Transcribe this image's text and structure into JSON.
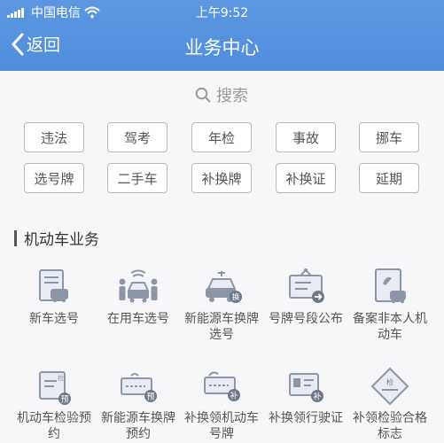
{
  "status_bar": {
    "carrier": "中国电信",
    "time": "上午9:52"
  },
  "nav": {
    "back_label": "返回",
    "title": "业务中心"
  },
  "search": {
    "placeholder": "搜索"
  },
  "tags": [
    "违法",
    "驾考",
    "年检",
    "事故",
    "挪车",
    "选号牌",
    "二手车",
    "补换牌",
    "补换证",
    "延期"
  ],
  "section": {
    "title": "机动车业务"
  },
  "services": [
    {
      "label": "新车选号",
      "icon": "new-car-number-icon"
    },
    {
      "label": "在用车选号",
      "icon": "car-in-use-icon"
    },
    {
      "label": "新能源车换牌选号",
      "icon": "ev-plate-icon"
    },
    {
      "label": "号牌号段公布",
      "icon": "plate-range-sign-icon"
    },
    {
      "label": "备案非本人机动车",
      "icon": "vehicle-record-icon"
    },
    {
      "label": "机动车检验预约",
      "icon": "inspection-booking-icon"
    },
    {
      "label": "新能源车换牌预约",
      "icon": "ev-plate-booking-icon"
    },
    {
      "label": "补换领机动车号牌",
      "icon": "plate-replace-icon"
    },
    {
      "label": "补换领行驶证",
      "icon": "license-replace-icon"
    },
    {
      "label": "补领检验合格标志",
      "icon": "inspection-badge-icon"
    }
  ],
  "colors": {
    "header": "#4f8ddc",
    "background": "#f7f7f9",
    "accent_icon": "#8c96a6"
  }
}
